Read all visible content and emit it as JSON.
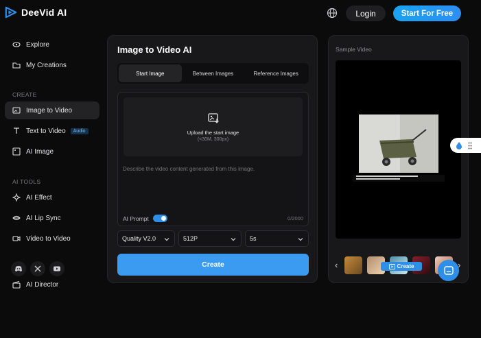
{
  "brand": {
    "name": "DeeVid AI",
    "accent": "#2f8fe8"
  },
  "header": {
    "login_label": "Login",
    "start_label": "Start For Free"
  },
  "sidebar": {
    "top_items": [
      {
        "label": "Explore",
        "icon": "compass-icon"
      },
      {
        "label": "My Creations",
        "icon": "folder-icon"
      }
    ],
    "create_label": "CREATE",
    "create_items": [
      {
        "label": "Image to Video",
        "icon": "image-icon"
      },
      {
        "label": "Text to Video",
        "icon": "text-icon",
        "badge": "Audio"
      },
      {
        "label": "AI Image",
        "icon": "picture-icon"
      }
    ],
    "tools_label": "AI TOOLS",
    "tools_items": [
      {
        "label": "AI Effect",
        "icon": "sparkle-icon"
      },
      {
        "label": "AI Lip Sync",
        "icon": "lips-icon"
      },
      {
        "label": "Video to Video",
        "icon": "video-icon"
      }
    ],
    "director_label": "AI Director",
    "social": [
      "discord-icon",
      "x-icon",
      "youtube-icon"
    ]
  },
  "main": {
    "title": "Image to Video AI",
    "tabs": [
      "Start Image",
      "Between Images",
      "Reference Images"
    ],
    "active_tab": "Start Image",
    "upload_title": "Upload the start image",
    "upload_sub": "(<30M, 300px)",
    "prompt_placeholder": "Describe the video content generated from this image.",
    "ai_prompt_label": "AI Prompt",
    "ai_prompt_on": true,
    "counter": "0/2000",
    "quality": "Quality V2.0",
    "resolution": "512P",
    "duration": "5s",
    "create_label": "Create"
  },
  "sample": {
    "title": "Sample Video",
    "mini_create_label": "Create"
  }
}
